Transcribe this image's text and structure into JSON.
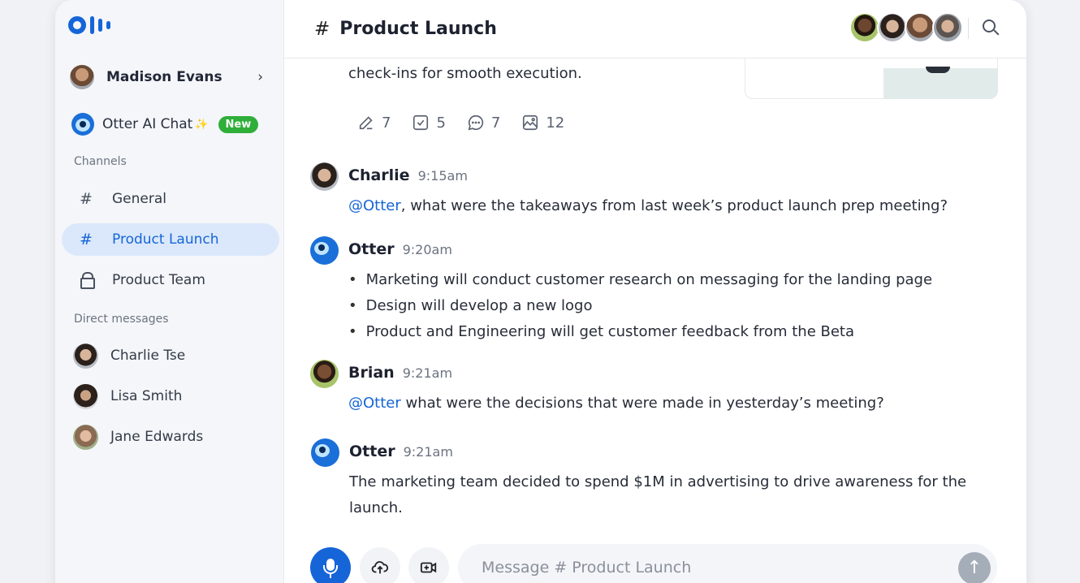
{
  "sidebar": {
    "user": {
      "name": "Madison Evans"
    },
    "ai_chat": {
      "label": "Otter AI Chat",
      "badge": "New"
    },
    "channels_label": "Channels",
    "channels": [
      {
        "name": "General",
        "icon": "hash-icon"
      },
      {
        "name": "Product Launch",
        "icon": "hash-icon",
        "active": true
      },
      {
        "name": "Product Team",
        "icon": "lock-icon"
      }
    ],
    "dm_label": "Direct messages",
    "direct_messages": [
      {
        "name": "Charlie Tse"
      },
      {
        "name": "Lisa Smith"
      },
      {
        "name": "Jane Edwards"
      }
    ]
  },
  "header": {
    "title": "Product Launch"
  },
  "prev_message": {
    "text": "check-ins for smooth execution.",
    "stats": {
      "edits": "7",
      "tasks": "5",
      "comments": "7",
      "images": "12"
    }
  },
  "messages": [
    {
      "author": "Charlie",
      "time": "9:15am",
      "mention": "@Otter",
      "text": ", what were the takeaways from last week’s product launch prep meeting?"
    },
    {
      "author": "Otter",
      "time": "9:20am",
      "bullets": [
        "Marketing will conduct customer research on messaging for the landing page",
        "Design will develop a new logo",
        "Product and Engineering will get customer feedback from the Beta"
      ]
    },
    {
      "author": "Brian",
      "time": "9:21am",
      "mention": "@Otter",
      "text": " what were the decisions that were made in yesterday’s meeting?"
    },
    {
      "author": "Otter",
      "time": "9:21am",
      "line1": "The marketing team decided to spend $1M in advertising to drive awareness for the",
      "line2": "launch."
    }
  ],
  "composer": {
    "placeholder": "Message # Product Launch"
  },
  "colors": {
    "accent": "#1565d8",
    "badge_green": "#2fae3a",
    "active_bg": "#dbe8fb"
  }
}
